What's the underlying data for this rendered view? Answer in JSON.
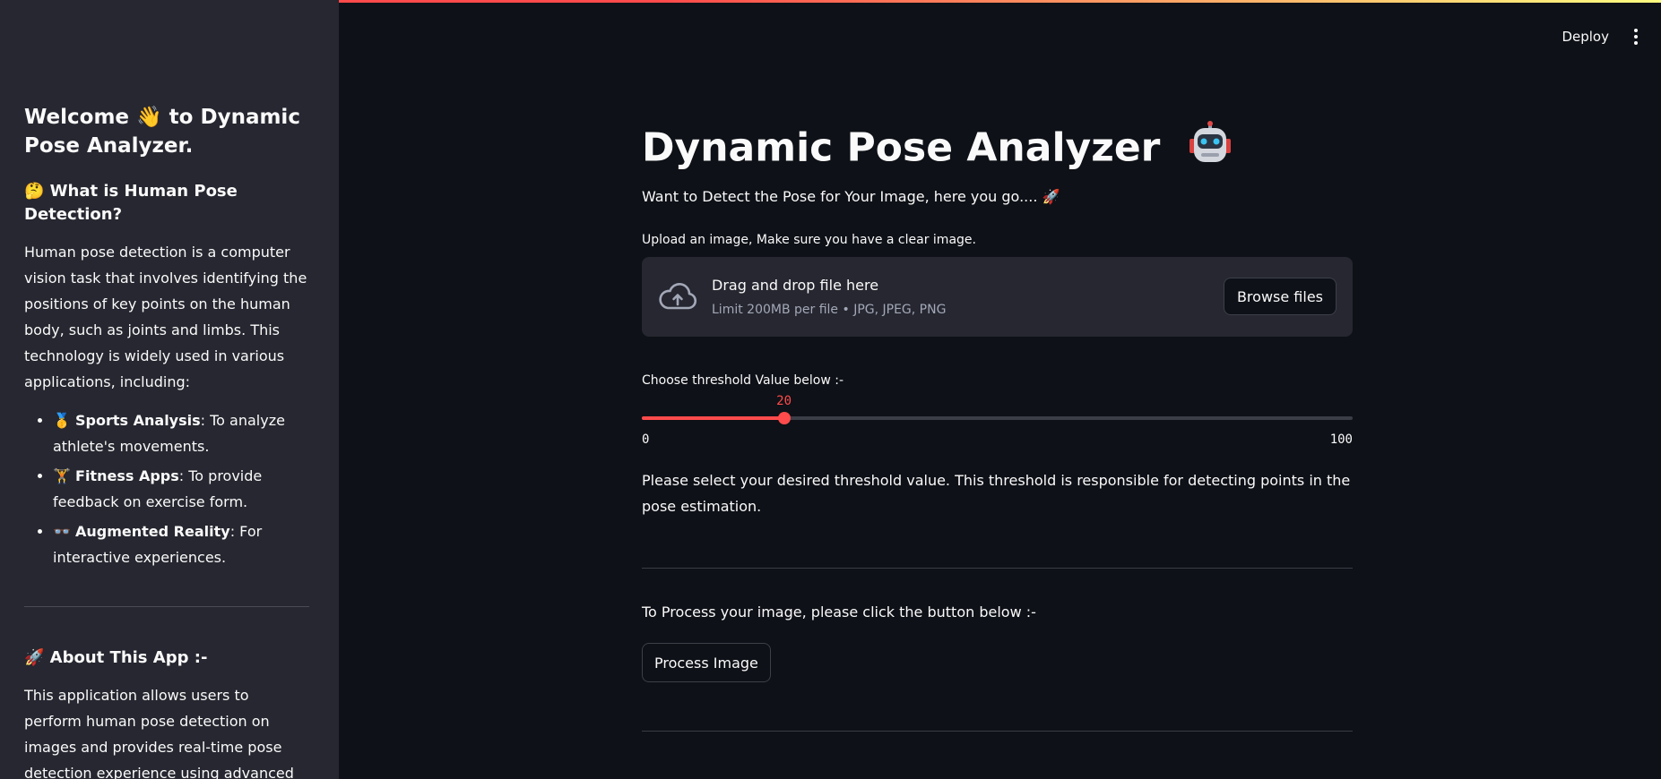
{
  "colors": {
    "background": "#0e1117",
    "sidebar": "#262730",
    "accent": "#ff4b4b",
    "text": "#fafafa",
    "muted": "#a3a8b8"
  },
  "header": {
    "deploy_label": "Deploy",
    "menu_icon": "kebab-menu-icon"
  },
  "sidebar": {
    "title": "Welcome 👋 to Dynamic Pose Analyzer.",
    "section1": {
      "heading": "🤔 What is Human Pose Detection?",
      "body": "Human pose detection is a computer vision task that involves identifying the positions of key points on the human body, such as joints and limbs. This technology is widely used in various applications, including:",
      "items": [
        {
          "emoji": "🥇",
          "bold": "Sports Analysis",
          "text": ": To analyze athlete's movements."
        },
        {
          "emoji": "🏋️",
          "bold": "Fitness Apps",
          "text": ": To provide feedback on exercise form."
        },
        {
          "emoji": "👓",
          "bold": "Augmented Reality",
          "text": ": For interactive experiences."
        }
      ]
    },
    "section2": {
      "heading": "🚀 About This App :-",
      "body": "This application allows users to perform human pose detection on images and provides real-time pose detection experience using advanced machine"
    }
  },
  "main": {
    "title": "Dynamic Pose Analyzer",
    "title_icon": "robot-icon",
    "subtitle": "Want to Detect the Pose for Your Image, here you go.... 🚀",
    "uploader": {
      "label": "Upload an image, Make sure you have a clear image.",
      "drag_text": "Drag and drop file here",
      "limit_text": "Limit 200MB per file • JPG, JPEG, PNG",
      "browse_label": "Browse files",
      "icon": "cloud-upload-icon"
    },
    "slider": {
      "label": "Choose threshold Value below :-",
      "value": 20,
      "min": 0,
      "max": 100
    },
    "threshold_description": "Please select your desired threshold value. This threshold is responsible for detecting points in the pose estimation.",
    "process_text": "To Process your image, please click the button below :-",
    "process_button": "Process Image"
  }
}
